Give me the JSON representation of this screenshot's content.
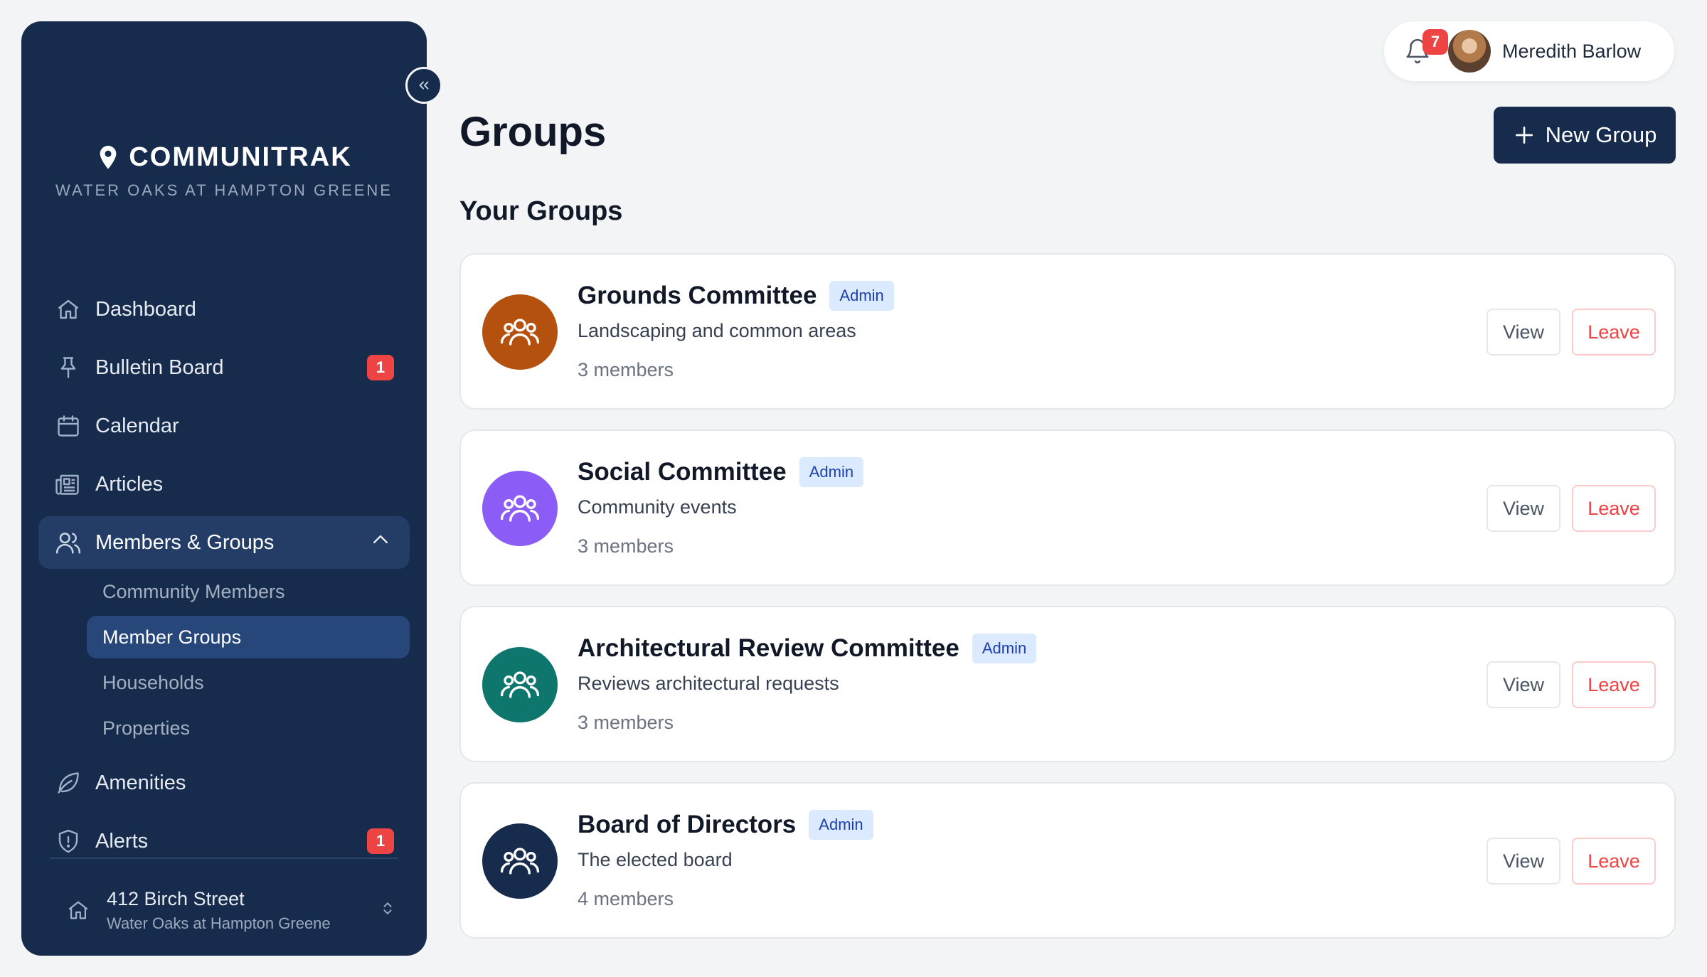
{
  "brand": {
    "name": "COMMUNITRAK",
    "community": "WATER OAKS AT HAMPTON GREENE"
  },
  "nav": {
    "dashboard": "Dashboard",
    "bulletin_board": "Bulletin Board",
    "bulletin_badge": "1",
    "calendar": "Calendar",
    "articles": "Articles",
    "members_groups": "Members & Groups",
    "sub": {
      "community_members": "Community Members",
      "member_groups": "Member Groups",
      "households": "Households",
      "properties": "Properties"
    },
    "amenities": "Amenities",
    "alerts": "Alerts",
    "alerts_badge": "1"
  },
  "property": {
    "address": "412 Birch Street",
    "community": "Water Oaks at Hampton Greene"
  },
  "user": {
    "name": "Meredith Barlow",
    "notification_count": "7"
  },
  "page": {
    "title": "Groups",
    "new_group_label": "New Group",
    "section_title": "Your Groups"
  },
  "groups": [
    {
      "name": "Grounds Committee",
      "badge": "Admin",
      "description": "Landscaping and common areas",
      "members": "3 members",
      "color": "#b5510f",
      "view_label": "View",
      "leave_label": "Leave"
    },
    {
      "name": "Social Committee",
      "badge": "Admin",
      "description": "Community events",
      "members": "3 members",
      "color": "#8b5cf6",
      "view_label": "View",
      "leave_label": "Leave"
    },
    {
      "name": "Architectural Review Committee",
      "badge": "Admin",
      "description": "Reviews architectural requests",
      "members": "3 members",
      "color": "#0f766e",
      "view_label": "View",
      "leave_label": "Leave"
    },
    {
      "name": "Board of Directors",
      "badge": "Admin",
      "description": "The elected board",
      "members": "4 members",
      "color": "#172c4d",
      "view_label": "View",
      "leave_label": "Leave"
    }
  ]
}
